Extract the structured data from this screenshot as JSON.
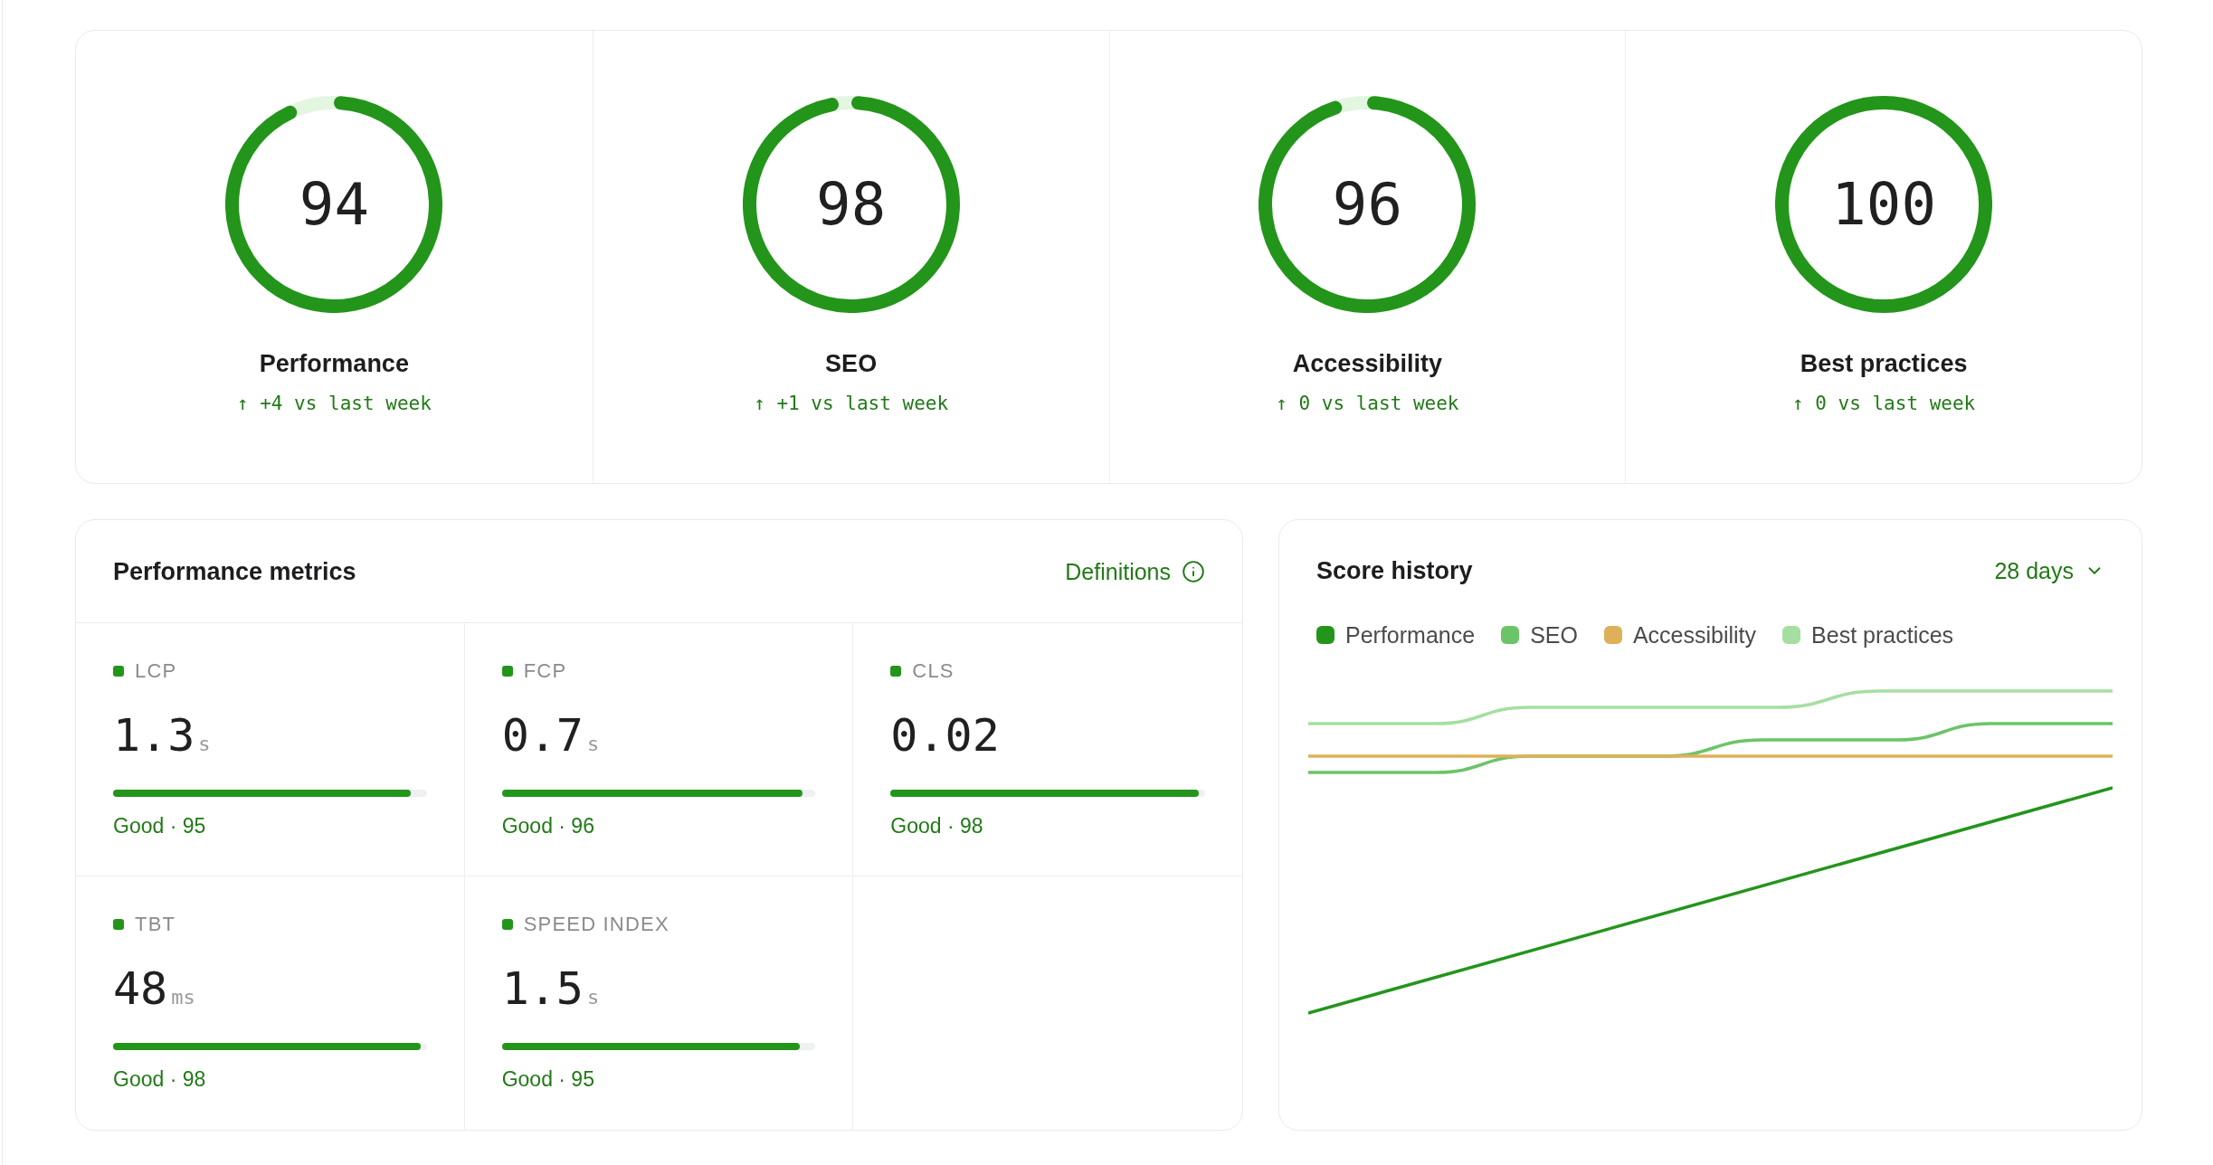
{
  "scores": [
    {
      "label": "Performance",
      "score": "94",
      "change": "↑ +4 vs last week"
    },
    {
      "label": "SEO",
      "score": "98",
      "change": "↑ +1 vs last week"
    },
    {
      "label": "Accessibility",
      "score": "96",
      "change": "↑ 0 vs last week"
    },
    {
      "label": "Best practices",
      "score": "100",
      "change": "↑ 0 vs last week"
    }
  ],
  "metrics_panel": {
    "title": "Performance metrics",
    "definitions_link": "Definitions",
    "metrics": [
      {
        "label": "LCP",
        "value": "1.3",
        "unit": "s",
        "level": 0.95,
        "rating": "Good · 95"
      },
      {
        "label": "FCP",
        "value": "0.7",
        "unit": "s",
        "level": 0.96,
        "rating": "Good · 96"
      },
      {
        "label": "CLS",
        "value": "0.02",
        "level": 0.98,
        "rating": "Good · 98"
      },
      {
        "label": "TBT",
        "value": "48",
        "unit": "ms",
        "level": 0.98,
        "rating": "Good · 98"
      },
      {
        "label": "SPEED INDEX",
        "value": "1.5",
        "unit": "s",
        "level": 0.95,
        "rating": "Good · 95"
      }
    ]
  },
  "history_panel": {
    "title": "Score history",
    "range": "28 days",
    "legend": [
      {
        "name": "Performance",
        "color": "#23951b"
      },
      {
        "name": "SEO",
        "color": "#6cc468"
      },
      {
        "name": "Accessibility",
        "color": "#dfb05a"
      },
      {
        "name": "Best practices",
        "color": "#a5dfa0"
      }
    ]
  }
}
